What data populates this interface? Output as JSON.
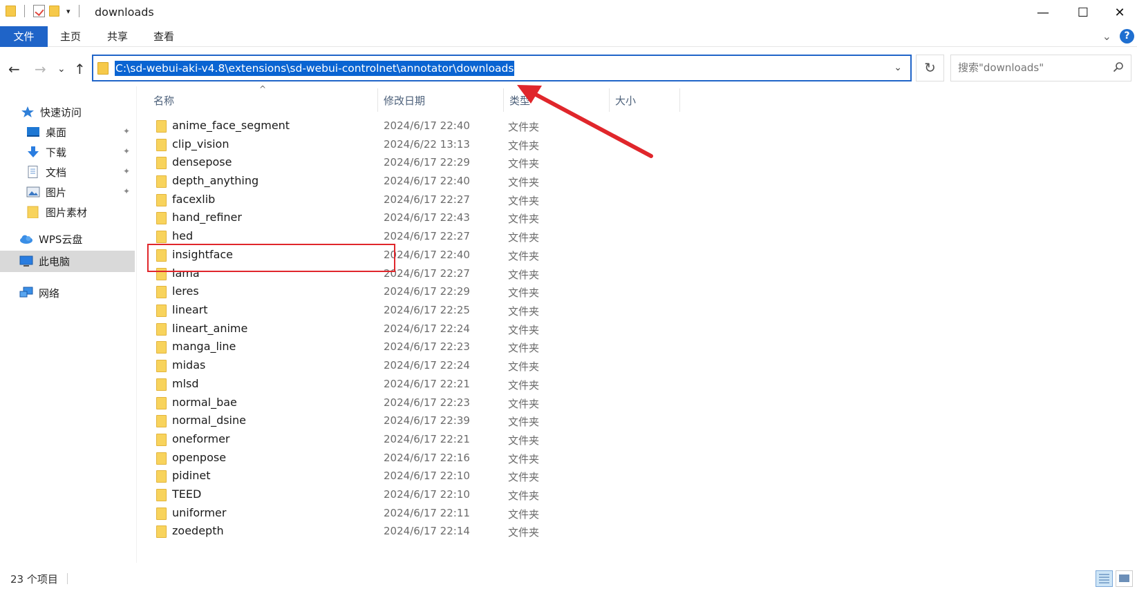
{
  "window": {
    "title": "downloads",
    "minimize_glyph": "—",
    "maximize_glyph": "☐",
    "close_glyph": "✕"
  },
  "ribbon": {
    "tabs": [
      "文件",
      "主页",
      "共享",
      "查看"
    ],
    "active_tab": "文件",
    "expand_glyph": "⌄",
    "help_glyph": "?"
  },
  "nav": {
    "back_glyph": "←",
    "forward_glyph": "→",
    "recent_glyph": "⌄",
    "up_glyph": "↑"
  },
  "address": {
    "path": "C:\\sd-webui-aki-v4.8\\extensions\\sd-webui-controlnet\\annotator\\downloads",
    "dropdown_glyph": "⌄",
    "refresh_glyph": "↻"
  },
  "search": {
    "placeholder": "搜索\"downloads\"",
    "icon_glyph": "⚲"
  },
  "sidebar": {
    "items": [
      {
        "label": "快速访问",
        "icon": "star-icon"
      },
      {
        "label": "桌面",
        "icon": "desktop-icon",
        "pinned": true
      },
      {
        "label": "下载",
        "icon": "download-arrow-icon",
        "pinned": true
      },
      {
        "label": "文档",
        "icon": "document-icon",
        "pinned": true
      },
      {
        "label": "图片",
        "icon": "pictures-icon",
        "pinned": true
      },
      {
        "label": "图片素材",
        "icon": "folder-icon"
      },
      {
        "label": "WPS云盘",
        "icon": "cloud-icon"
      },
      {
        "label": "此电脑",
        "icon": "computer-icon",
        "selected": true
      },
      {
        "label": "网络",
        "icon": "network-icon"
      }
    ],
    "pin_glyph": "📌"
  },
  "columns": {
    "name": "名称",
    "modified": "修改日期",
    "type": "类型",
    "size": "大小",
    "sort_glyph": "^"
  },
  "files": [
    {
      "name": "anime_face_segment",
      "date": "2024/6/17 22:40",
      "type": "文件夹"
    },
    {
      "name": "clip_vision",
      "date": "2024/6/22 13:13",
      "type": "文件夹"
    },
    {
      "name": "densepose",
      "date": "2024/6/17 22:29",
      "type": "文件夹"
    },
    {
      "name": "depth_anything",
      "date": "2024/6/17 22:40",
      "type": "文件夹"
    },
    {
      "name": "facexlib",
      "date": "2024/6/17 22:27",
      "type": "文件夹"
    },
    {
      "name": "hand_refiner",
      "date": "2024/6/17 22:43",
      "type": "文件夹"
    },
    {
      "name": "hed",
      "date": "2024/6/17 22:27",
      "type": "文件夹"
    },
    {
      "name": "insightface",
      "date": "2024/6/17 22:40",
      "type": "文件夹"
    },
    {
      "name": "lama",
      "date": "2024/6/17 22:27",
      "type": "文件夹"
    },
    {
      "name": "leres",
      "date": "2024/6/17 22:29",
      "type": "文件夹"
    },
    {
      "name": "lineart",
      "date": "2024/6/17 22:25",
      "type": "文件夹"
    },
    {
      "name": "lineart_anime",
      "date": "2024/6/17 22:24",
      "type": "文件夹"
    },
    {
      "name": "manga_line",
      "date": "2024/6/17 22:23",
      "type": "文件夹"
    },
    {
      "name": "midas",
      "date": "2024/6/17 22:24",
      "type": "文件夹"
    },
    {
      "name": "mlsd",
      "date": "2024/6/17 22:21",
      "type": "文件夹"
    },
    {
      "name": "normal_bae",
      "date": "2024/6/17 22:23",
      "type": "文件夹"
    },
    {
      "name": "normal_dsine",
      "date": "2024/6/17 22:39",
      "type": "文件夹"
    },
    {
      "name": "oneformer",
      "date": "2024/6/17 22:21",
      "type": "文件夹"
    },
    {
      "name": "openpose",
      "date": "2024/6/17 22:16",
      "type": "文件夹"
    },
    {
      "name": "pidinet",
      "date": "2024/6/17 22:10",
      "type": "文件夹"
    },
    {
      "name": "TEED",
      "date": "2024/6/17 22:10",
      "type": "文件夹"
    },
    {
      "name": "uniformer",
      "date": "2024/6/17 22:11",
      "type": "文件夹"
    },
    {
      "name": "zoedepth",
      "date": "2024/6/17 22:14",
      "type": "文件夹"
    }
  ],
  "status": {
    "item_count": "23 个项目"
  },
  "colors": {
    "accent": "#1f64c8",
    "selection": "#0a64d2",
    "annotation": "#e0262b",
    "folder": "#f8d35c"
  }
}
